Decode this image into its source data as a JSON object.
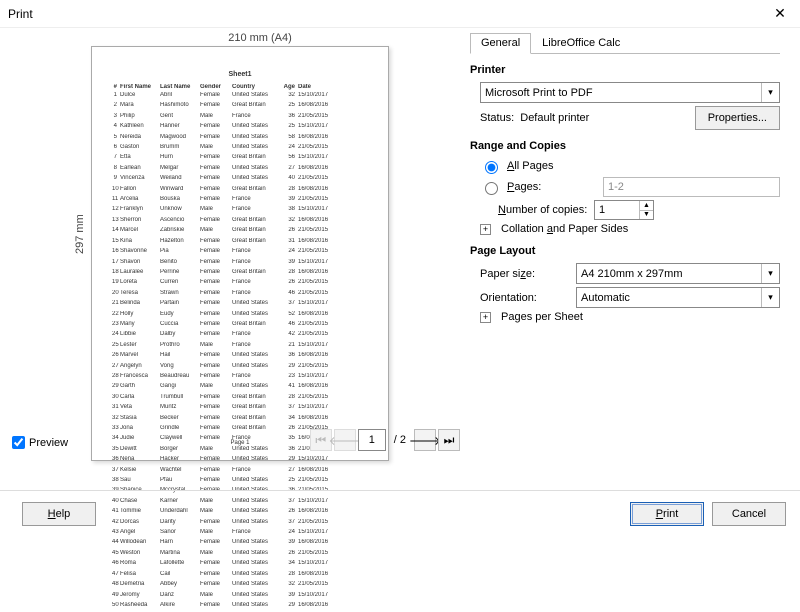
{
  "window": {
    "title": "Print"
  },
  "preview": {
    "top_dim": "210 mm (A4)",
    "left_dim": "297 mm",
    "sheet_name": "Sheet1",
    "page_label": "Page 1",
    "columns": [
      "#",
      "First Name",
      "Last Name",
      "Gender",
      "Country",
      "Age",
      "Date"
    ],
    "rows": [
      {
        "n": 1,
        "fn": "Dulce",
        "ln": "Abril",
        "g": "Female",
        "c": "United States",
        "a": 32,
        "d": "15/10/2017"
      },
      {
        "n": 2,
        "fn": "Mara",
        "ln": "Hashimoto",
        "g": "Female",
        "c": "Great Britain",
        "a": 25,
        "d": "16/08/2016"
      },
      {
        "n": 3,
        "fn": "Philip",
        "ln": "Gent",
        "g": "Male",
        "c": "France",
        "a": 36,
        "d": "21/05/2015"
      },
      {
        "n": 4,
        "fn": "Kathleen",
        "ln": "Hanner",
        "g": "Female",
        "c": "United States",
        "a": 25,
        "d": "15/10/2017"
      },
      {
        "n": 5,
        "fn": "Nereida",
        "ln": "Magwood",
        "g": "Female",
        "c": "United States",
        "a": 58,
        "d": "16/08/2016"
      },
      {
        "n": 6,
        "fn": "Gaston",
        "ln": "Brumm",
        "g": "Male",
        "c": "United States",
        "a": 24,
        "d": "21/05/2015"
      },
      {
        "n": 7,
        "fn": "Etta",
        "ln": "Hurn",
        "g": "Female",
        "c": "Great Britain",
        "a": 56,
        "d": "15/10/2017"
      },
      {
        "n": 8,
        "fn": "Earlean",
        "ln": "Melgar",
        "g": "Female",
        "c": "United States",
        "a": 27,
        "d": "16/08/2016"
      },
      {
        "n": 9,
        "fn": "Vincenza",
        "ln": "Weiland",
        "g": "Female",
        "c": "United States",
        "a": 40,
        "d": "21/05/2015"
      },
      {
        "n": 10,
        "fn": "Fallon",
        "ln": "Winward",
        "g": "Female",
        "c": "Great Britain",
        "a": 28,
        "d": "16/08/2016"
      },
      {
        "n": 11,
        "fn": "Arcelia",
        "ln": "Bouska",
        "g": "Female",
        "c": "France",
        "a": 39,
        "d": "21/05/2015"
      },
      {
        "n": 12,
        "fn": "Franklyn",
        "ln": "Unknow",
        "g": "Male",
        "c": "France",
        "a": 38,
        "d": "15/10/2017"
      },
      {
        "n": 13,
        "fn": "Sherron",
        "ln": "Ascencio",
        "g": "Female",
        "c": "Great Britain",
        "a": 32,
        "d": "16/08/2016"
      },
      {
        "n": 14,
        "fn": "Marcel",
        "ln": "Zabriskie",
        "g": "Male",
        "c": "Great Britain",
        "a": 26,
        "d": "21/05/2015"
      },
      {
        "n": 15,
        "fn": "Kina",
        "ln": "Hazelton",
        "g": "Female",
        "c": "Great Britain",
        "a": 31,
        "d": "16/08/2016"
      },
      {
        "n": 16,
        "fn": "Shavonne",
        "ln": "Pia",
        "g": "Female",
        "c": "France",
        "a": 24,
        "d": "21/05/2015"
      },
      {
        "n": 17,
        "fn": "Shavon",
        "ln": "Benito",
        "g": "Female",
        "c": "France",
        "a": 39,
        "d": "15/10/2017"
      },
      {
        "n": 18,
        "fn": "Lauralee",
        "ln": "Perrine",
        "g": "Female",
        "c": "Great Britain",
        "a": 28,
        "d": "16/08/2016"
      },
      {
        "n": 19,
        "fn": "Loreta",
        "ln": "Curren",
        "g": "Female",
        "c": "France",
        "a": 26,
        "d": "21/05/2015"
      },
      {
        "n": 20,
        "fn": "Teresa",
        "ln": "Strawn",
        "g": "Female",
        "c": "France",
        "a": 46,
        "d": "21/05/2015"
      },
      {
        "n": 21,
        "fn": "Belinda",
        "ln": "Partain",
        "g": "Female",
        "c": "United States",
        "a": 37,
        "d": "15/10/2017"
      },
      {
        "n": 22,
        "fn": "Holly",
        "ln": "Eudy",
        "g": "Female",
        "c": "United States",
        "a": 52,
        "d": "16/08/2016"
      },
      {
        "n": 23,
        "fn": "Many",
        "ln": "Cuccia",
        "g": "Female",
        "c": "Great Britain",
        "a": 46,
        "d": "21/05/2015"
      },
      {
        "n": 24,
        "fn": "Libbie",
        "ln": "Dalby",
        "g": "Female",
        "c": "France",
        "a": 42,
        "d": "21/05/2015"
      },
      {
        "n": 25,
        "fn": "Lester",
        "ln": "Prothro",
        "g": "Male",
        "c": "France",
        "a": 21,
        "d": "15/10/2017"
      },
      {
        "n": 26,
        "fn": "Marvel",
        "ln": "Hail",
        "g": "Female",
        "c": "United States",
        "a": 36,
        "d": "16/08/2016"
      },
      {
        "n": 27,
        "fn": "Angelyn",
        "ln": "Vong",
        "g": "Female",
        "c": "United States",
        "a": 29,
        "d": "21/05/2015"
      },
      {
        "n": 28,
        "fn": "Francesca",
        "ln": "Beaudreau",
        "g": "Female",
        "c": "France",
        "a": 23,
        "d": "15/10/2017"
      },
      {
        "n": 29,
        "fn": "Garth",
        "ln": "Gangi",
        "g": "Male",
        "c": "United States",
        "a": 41,
        "d": "16/08/2016"
      },
      {
        "n": 30,
        "fn": "Carla",
        "ln": "Trumbull",
        "g": "Female",
        "c": "Great Britain",
        "a": 28,
        "d": "21/05/2015"
      },
      {
        "n": 31,
        "fn": "Veta",
        "ln": "Muntz",
        "g": "Female",
        "c": "Great Britain",
        "a": 37,
        "d": "15/10/2017"
      },
      {
        "n": 32,
        "fn": "Stasia",
        "ln": "Becker",
        "g": "Female",
        "c": "Great Britain",
        "a": 34,
        "d": "16/08/2016"
      },
      {
        "n": 33,
        "fn": "Jona",
        "ln": "Grindle",
        "g": "Female",
        "c": "Great Britain",
        "a": 26,
        "d": "21/05/2015"
      },
      {
        "n": 34,
        "fn": "Judie",
        "ln": "Claywell",
        "g": "Female",
        "c": "France",
        "a": 35,
        "d": "16/08/2016"
      },
      {
        "n": 35,
        "fn": "Dewitt",
        "ln": "Borger",
        "g": "Male",
        "c": "United States",
        "a": 36,
        "d": "21/05/2015"
      },
      {
        "n": 36,
        "fn": "Nena",
        "ln": "Hacker",
        "g": "Female",
        "c": "United States",
        "a": 29,
        "d": "15/10/2017"
      },
      {
        "n": 37,
        "fn": "Kelsie",
        "ln": "Wachtel",
        "g": "Female",
        "c": "France",
        "a": 27,
        "d": "16/08/2016"
      },
      {
        "n": 38,
        "fn": "Sau",
        "ln": "Pfau",
        "g": "Female",
        "c": "United States",
        "a": 25,
        "d": "21/05/2015"
      },
      {
        "n": 39,
        "fn": "Shanice",
        "ln": "Mccrystal",
        "g": "Female",
        "c": "United States",
        "a": 36,
        "d": "21/05/2015"
      },
      {
        "n": 40,
        "fn": "Chase",
        "ln": "Karner",
        "g": "Male",
        "c": "United States",
        "a": 37,
        "d": "15/10/2017"
      },
      {
        "n": 41,
        "fn": "Tommie",
        "ln": "Underdahl",
        "g": "Male",
        "c": "United States",
        "a": 26,
        "d": "16/08/2016"
      },
      {
        "n": 42,
        "fn": "Dorcas",
        "ln": "Darity",
        "g": "Female",
        "c": "United States",
        "a": 37,
        "d": "21/05/2015"
      },
      {
        "n": 43,
        "fn": "Angel",
        "ln": "Sanor",
        "g": "Male",
        "c": "France",
        "a": 24,
        "d": "15/10/2017"
      },
      {
        "n": 44,
        "fn": "Willodean",
        "ln": "Harn",
        "g": "Female",
        "c": "United States",
        "a": 39,
        "d": "16/08/2016"
      },
      {
        "n": 45,
        "fn": "Weston",
        "ln": "Martina",
        "g": "Male",
        "c": "United States",
        "a": 26,
        "d": "21/05/2015"
      },
      {
        "n": 46,
        "fn": "Roma",
        "ln": "Lafollette",
        "g": "Female",
        "c": "United States",
        "a": 34,
        "d": "15/10/2017"
      },
      {
        "n": 47,
        "fn": "Felisa",
        "ln": "Cail",
        "g": "Female",
        "c": "United States",
        "a": 28,
        "d": "16/08/2016"
      },
      {
        "n": 48,
        "fn": "Demetria",
        "ln": "Abbey",
        "g": "Female",
        "c": "United States",
        "a": 32,
        "d": "21/05/2015"
      },
      {
        "n": 49,
        "fn": "Jeromy",
        "ln": "Danz",
        "g": "Male",
        "c": "United States",
        "a": 39,
        "d": "15/10/2017"
      },
      {
        "n": 50,
        "fn": "Rasheeda",
        "ln": "Alkire",
        "g": "Female",
        "c": "United States",
        "a": 29,
        "d": "16/08/2016"
      }
    ]
  },
  "pager": {
    "current": "1",
    "total": "/ 2"
  },
  "preview_checkbox": {
    "label": "Preview",
    "checked": true
  },
  "tabs": {
    "general": "General",
    "calc": "LibreOffice Calc"
  },
  "printer": {
    "heading": "Printer",
    "selected": "Microsoft Print to PDF",
    "status_label": "Status:",
    "status_value": "Default printer",
    "properties_btn": "Properties..."
  },
  "range": {
    "heading": "Range and Copies",
    "all_pages": "All Pages",
    "pages_label": "Pages:",
    "pages_placeholder": "1-2",
    "copies_label": "Number of copies:",
    "copies_value": "1",
    "collation": "Collation and Paper Sides"
  },
  "layout": {
    "heading": "Page Layout",
    "paper_label": "Paper size:",
    "paper_value": "A4 210mm x 297mm",
    "orient_label": "Orientation:",
    "orient_value": "Automatic",
    "pps": "Pages per Sheet"
  },
  "footer": {
    "help": "Help",
    "print": "Print",
    "cancel": "Cancel"
  }
}
